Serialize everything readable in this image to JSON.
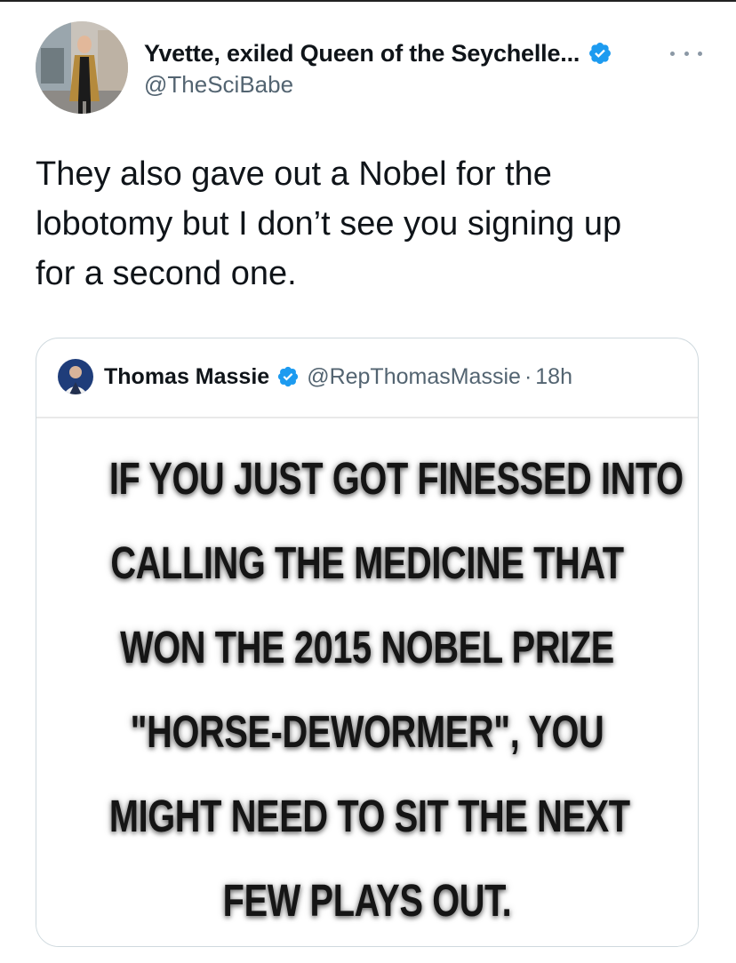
{
  "tweet": {
    "display_name": "Yvette, exiled Queen of the Seychelle...",
    "handle": "@TheSciBabe",
    "text": "They also gave out a Nobel for the\nlobotomy but I don’t see you signing up\nfor a second one.",
    "verified_icon": "verified-badge-icon",
    "more_icon": "more-options-icon"
  },
  "quote": {
    "display_name": "Thomas Massie",
    "handle": "@RepThomasMassie",
    "separator": "·",
    "time": "18h",
    "meme_lines": [
      "IF YOU JUST GOT FINESSED INTO",
      "CALLING THE MEDICINE THAT",
      "WON THE 2015 NOBEL PRIZE",
      "\"HORSE-DEWORMER\", YOU",
      "MIGHT NEED TO SIT THE NEXT",
      "FEW PLAYS OUT."
    ]
  },
  "colors": {
    "verified_blue": "#1d9bf0",
    "secondary_text": "#536471",
    "border": "#cfd9de"
  }
}
